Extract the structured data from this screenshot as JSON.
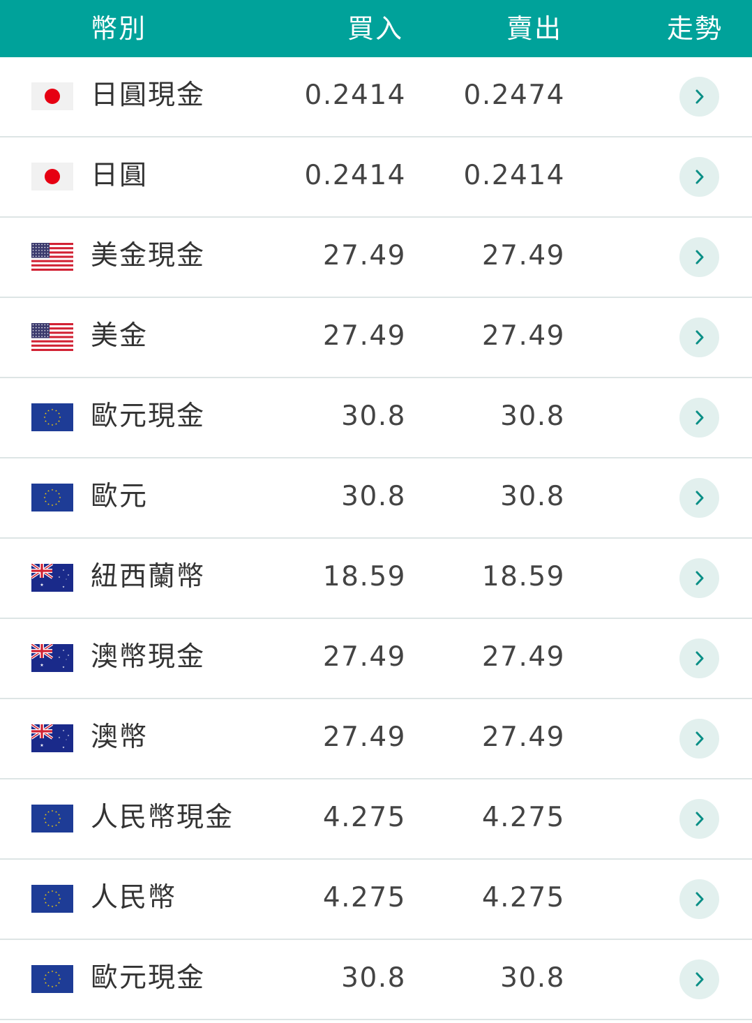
{
  "header": {
    "currency": "幣別",
    "buy": "買入",
    "sell": "賣出",
    "trend": "走勢"
  },
  "colors": {
    "header_bg": "#00a29a",
    "divider": "#dde5e5",
    "trend_button_bg": "#e2f0ee",
    "trend_chevron": "#0a8f86"
  },
  "rows": [
    {
      "flag": "japan-flag-icon",
      "name": "日圓現金",
      "buy": "0.2414",
      "sell": "0.2474"
    },
    {
      "flag": "japan-flag-icon",
      "name": "日圓",
      "buy": "0.2414",
      "sell": "0.2414"
    },
    {
      "flag": "usa-flag-icon",
      "name": "美金現金",
      "buy": "27.49",
      "sell": "27.49"
    },
    {
      "flag": "usa-flag-icon",
      "name": "美金",
      "buy": "27.49",
      "sell": "27.49"
    },
    {
      "flag": "eu-flag-icon",
      "name": "歐元現金",
      "buy": "30.8",
      "sell": "30.8"
    },
    {
      "flag": "eu-flag-icon",
      "name": "歐元",
      "buy": "30.8",
      "sell": "30.8"
    },
    {
      "flag": "australia-flag-icon",
      "name": "紐西蘭幣",
      "buy": "18.59",
      "sell": "18.59"
    },
    {
      "flag": "australia-flag-icon",
      "name": "澳幣現金",
      "buy": "27.49",
      "sell": "27.49"
    },
    {
      "flag": "australia-flag-icon",
      "name": "澳幣",
      "buy": "27.49",
      "sell": "27.49"
    },
    {
      "flag": "eu-flag-icon",
      "name": "人民幣現金",
      "buy": "4.275",
      "sell": "4.275"
    },
    {
      "flag": "eu-flag-icon",
      "name": "人民幣",
      "buy": "4.275",
      "sell": "4.275"
    },
    {
      "flag": "eu-flag-icon",
      "name": "歐元現金",
      "buy": "30.8",
      "sell": "30.8"
    }
  ]
}
